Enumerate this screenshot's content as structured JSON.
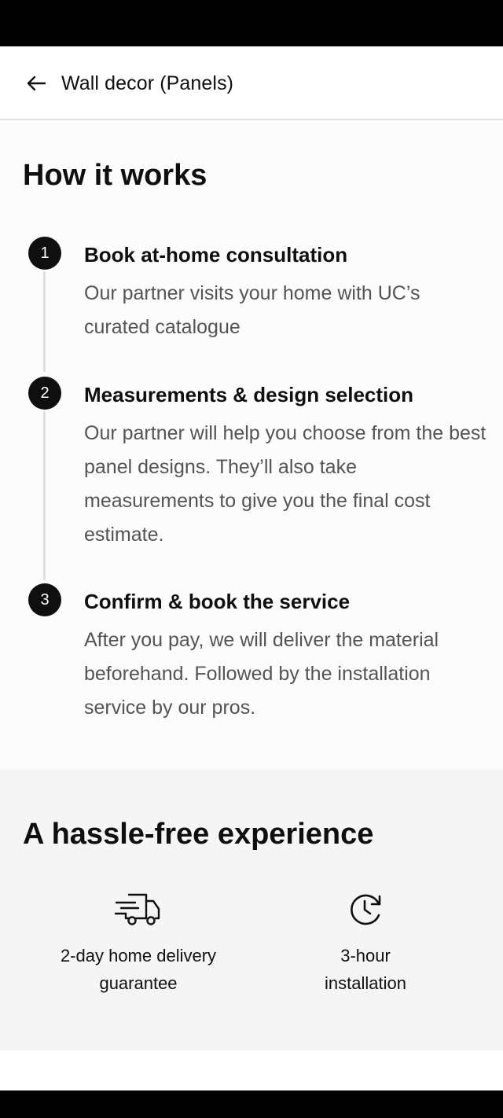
{
  "header": {
    "title": "Wall decor (Panels)",
    "back_icon": "arrow-left-icon"
  },
  "how_it_works": {
    "title": "How it works",
    "steps": [
      {
        "number": "1",
        "title": "Book at-home consultation",
        "description": "Our partner visits your home with UC’s curated catalogue"
      },
      {
        "number": "2",
        "title": "Measurements & design selection",
        "description": "Our partner will help you choose from the best panel designs. They’ll also take measurements to give you the final cost estimate."
      },
      {
        "number": "3",
        "title": "Confirm & book the service",
        "description": "After you pay, we will deliver the material beforehand. Followed by the installation service by our pros."
      }
    ]
  },
  "hassle_free": {
    "title": "A hassle-free experience",
    "features": [
      {
        "icon": "delivery-truck-icon",
        "label_line1": "2-day home delivery",
        "label_line2": "guarantee"
      },
      {
        "icon": "clock-icon",
        "label_line1": "3-hour",
        "label_line2": "installation"
      }
    ]
  },
  "colors": {
    "text_primary": "#0f0f0f",
    "text_secondary": "#545454",
    "section_background": "#f5f5f5",
    "step_badge": "#0f0f0f"
  }
}
